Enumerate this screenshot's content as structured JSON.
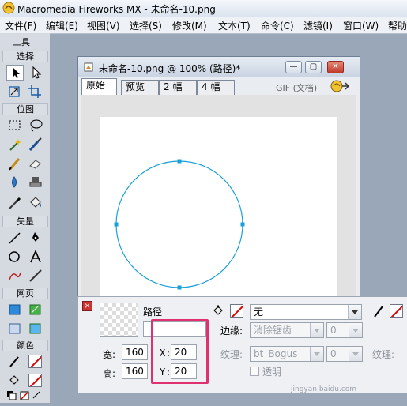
{
  "app": {
    "window_title": "Macromedia Fireworks MX - 未命名-10.png"
  },
  "menubar": {
    "items": [
      "文件(F)",
      "编辑(E)",
      "视图(V)",
      "选择(S)",
      "修改(M)",
      "文本(T)",
      "命令(C)",
      "滤镜(I)",
      "窗口(W)",
      "帮助"
    ]
  },
  "toolbox": {
    "title": "工具",
    "sections": {
      "select": "选择",
      "bitmap": "位图",
      "vector": "矢量",
      "web": "网页",
      "colors": "颜色"
    }
  },
  "document": {
    "title": "未命名-10.png @  100% (路径)*",
    "tabs": [
      "原始",
      "预览",
      "2 幅",
      "4 幅"
    ],
    "active_tab": "原始",
    "format_label": "GIF (文档)"
  },
  "properties": {
    "object_type": "路径",
    "name_value": "",
    "width_label": "宽:",
    "width_value": "160",
    "height_label": "高:",
    "height_value": "160",
    "x_label": "X:",
    "x_value": "20",
    "y_label": "Y:",
    "y_value": "20",
    "fill_value": "无",
    "edge_label": "边缘:",
    "edge_value": "消除锯齿",
    "edge_amount": "0",
    "texture_label": "纹理:",
    "texture_value": "bt_Bogus",
    "texture_amount": "0",
    "transparent_label": "透明",
    "stroke_texture_label": "纹理:"
  },
  "watermark": "jingyan.baidu.com",
  "colors": {
    "path_stroke": "#1aa0d8",
    "highlight": "#e0306f"
  }
}
